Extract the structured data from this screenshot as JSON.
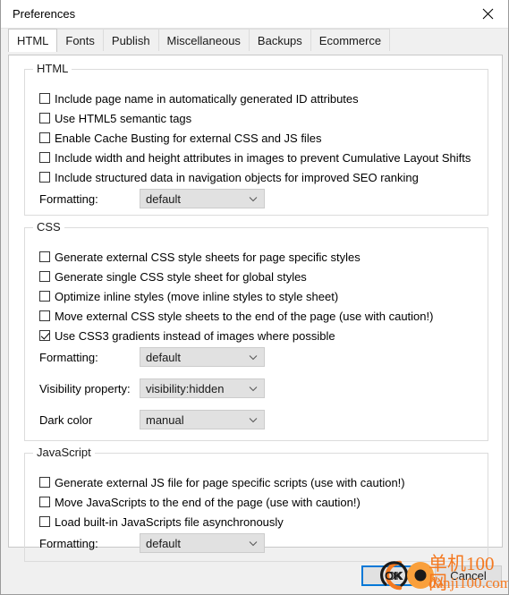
{
  "window": {
    "title": "Preferences",
    "close_icon": "close-icon"
  },
  "tabs": [
    {
      "label": "HTML",
      "active": true
    },
    {
      "label": "Fonts",
      "active": false
    },
    {
      "label": "Publish",
      "active": false
    },
    {
      "label": "Miscellaneous",
      "active": false
    },
    {
      "label": "Backups",
      "active": false
    },
    {
      "label": "Ecommerce",
      "active": false
    }
  ],
  "groups": {
    "html": {
      "title": "HTML",
      "checkboxes": [
        {
          "label": "Include page name in automatically generated ID attributes",
          "checked": false
        },
        {
          "label": "Use HTML5 semantic tags",
          "checked": false
        },
        {
          "label": "Enable Cache Busting for external CSS and JS files",
          "checked": false
        },
        {
          "label": "Include width and height attributes in images to prevent Cumulative Layout Shifts",
          "checked": false
        },
        {
          "label": "Include structured data in navigation objects for improved SEO ranking",
          "checked": false
        }
      ],
      "fields": [
        {
          "label": "Formatting:",
          "value": "default",
          "arrow_icon": "chevron-down-icon"
        }
      ]
    },
    "css": {
      "title": "CSS",
      "checkboxes": [
        {
          "label": "Generate external CSS style sheets for page specific styles",
          "checked": false
        },
        {
          "label": "Generate single CSS style sheet for global styles",
          "checked": false
        },
        {
          "label": "Optimize inline styles (move inline styles to style sheet)",
          "checked": false
        },
        {
          "label": "Move external CSS style sheets to the end of the page (use with caution!)",
          "checked": false
        },
        {
          "label": "Use CSS3 gradients instead of images where possible",
          "checked": true
        }
      ],
      "fields": [
        {
          "label": "Formatting:",
          "value": "default",
          "arrow_icon": "chevron-down-icon"
        },
        {
          "label": "Visibility property:",
          "value": "visibility:hidden",
          "arrow_icon": "chevron-down-icon"
        },
        {
          "label": "Dark color",
          "value": "manual",
          "arrow_icon": "chevron-down-icon"
        }
      ]
    },
    "javascript": {
      "title": "JavaScript",
      "checkboxes": [
        {
          "label": "Generate external JS file for page specific scripts (use with caution!)",
          "checked": false
        },
        {
          "label": "Move JavaScripts to the end of the page (use with caution!)",
          "checked": false
        },
        {
          "label": "Load built-in JavaScripts file asynchronously",
          "checked": false
        }
      ],
      "fields": [
        {
          "label": "Formatting:",
          "value": "default",
          "arrow_icon": "chevron-down-icon"
        }
      ]
    }
  },
  "buttons": {
    "ok": "OK",
    "cancel": "Cancel"
  },
  "watermark": {
    "cn": "单机100网",
    "en": "danji100.com",
    "color": "#f47920"
  }
}
